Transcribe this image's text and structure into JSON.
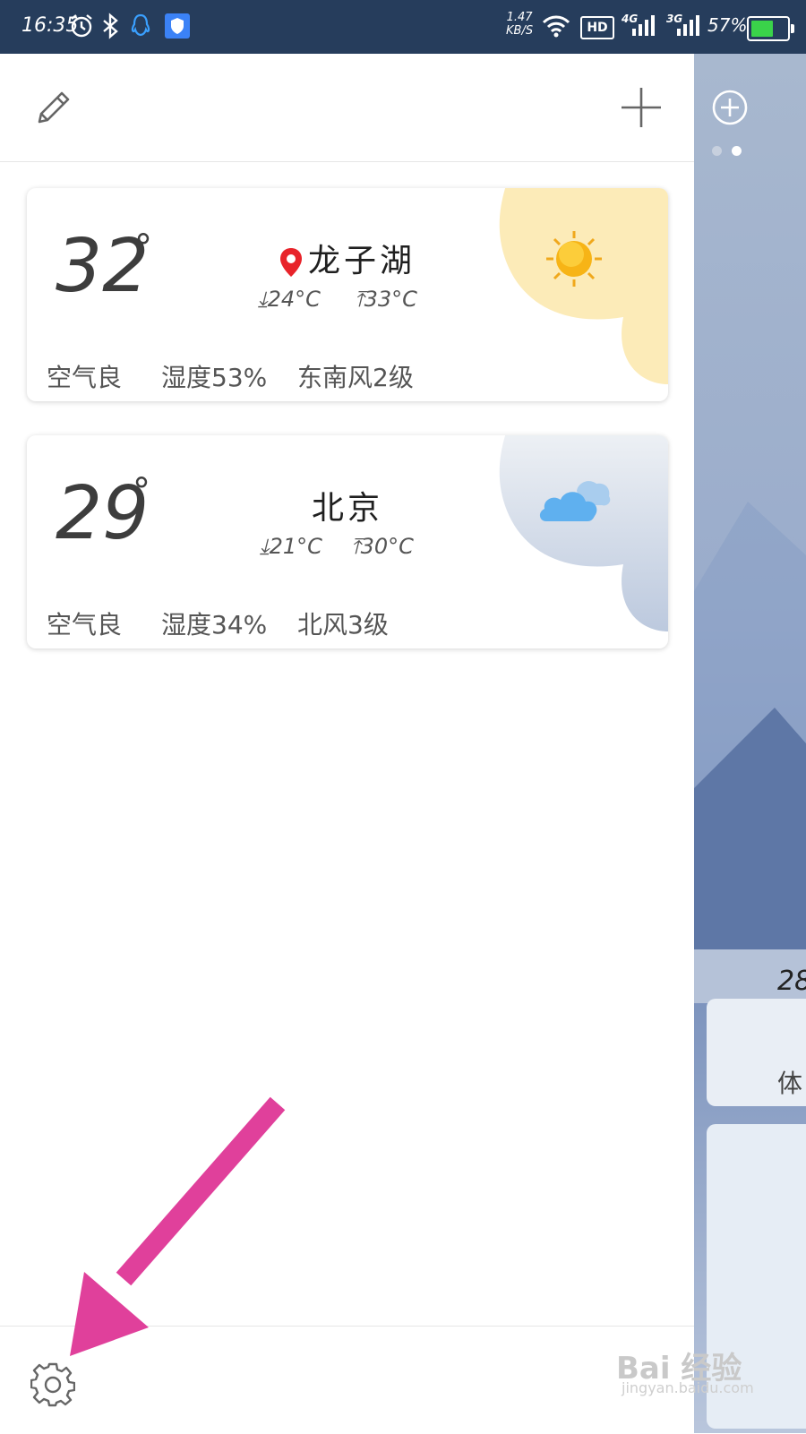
{
  "status_bar": {
    "time": "16:35",
    "net_speed_value": "1.47",
    "net_speed_unit": "KB/S",
    "hd_label": "HD",
    "net1": "4G",
    "net2": "3G",
    "battery": "57%",
    "battery_level": 0.57,
    "icons": [
      "alarm-icon",
      "bluetooth-icon",
      "qq-icon",
      "shield-icon",
      "wifi-icon",
      "signal-icon",
      "signal-icon",
      "battery-icon"
    ]
  },
  "toolbar": {
    "edit_icon": "pencil-icon",
    "add_icon": "plus-icon"
  },
  "cities": [
    {
      "temp": "32",
      "deg": "°",
      "name": "龙子湖",
      "located": true,
      "low": "24°C",
      "high": "33°C",
      "air": "空气良",
      "humidity": "湿度53%",
      "wind": "东南风2级",
      "weather_icon": "sun-icon",
      "corner_color": "#fcebb8"
    },
    {
      "temp": "29",
      "deg": "°",
      "name": "北京",
      "located": false,
      "low": "21°C",
      "high": "30°C",
      "air": "空气良",
      "humidity": "湿度34%",
      "wind": "北风3级",
      "weather_icon": "cloud-icon",
      "corner_color": "#d7dfeb"
    }
  ],
  "bottom_bar": {
    "settings_icon": "gear-icon"
  },
  "background_page": {
    "temp": "28",
    "feel": "体"
  },
  "watermark": {
    "main": "Bai 经验",
    "sub": "jingyan.baidu.com"
  }
}
